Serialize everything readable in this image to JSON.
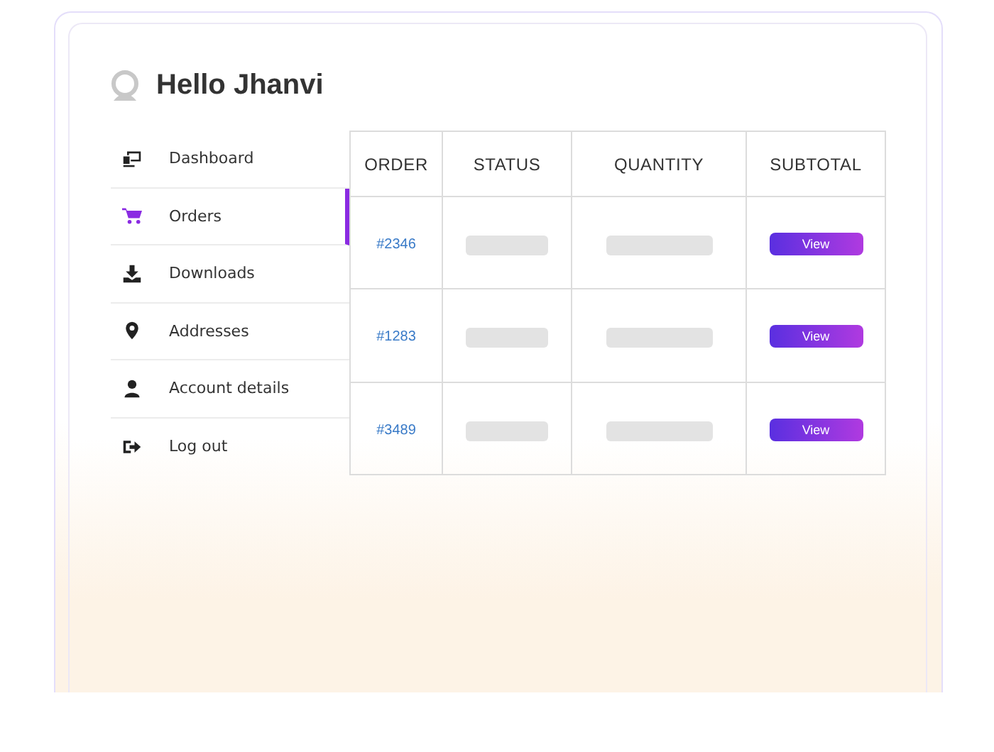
{
  "greeting": "Hello Jhanvi",
  "menu": [
    {
      "label": "Dashboard",
      "kind": "dashboard",
      "selected": false
    },
    {
      "label": "Orders",
      "kind": "cart",
      "selected": true
    },
    {
      "label": "Downloads",
      "kind": "download",
      "selected": false
    },
    {
      "label": "Addresses",
      "kind": "pin",
      "selected": false
    },
    {
      "label": "Account details",
      "kind": "user",
      "selected": false
    },
    {
      "label": "Log out",
      "kind": "logout",
      "selected": false
    }
  ],
  "table": {
    "columns": [
      "ORDER",
      "STATUS",
      "QUANTITY",
      "SUBTOTAL"
    ],
    "rows": [
      {
        "order": "#2346",
        "action": "View"
      },
      {
        "order": "#1283",
        "action": "View"
      },
      {
        "order": "#3489",
        "action": "View"
      }
    ]
  }
}
